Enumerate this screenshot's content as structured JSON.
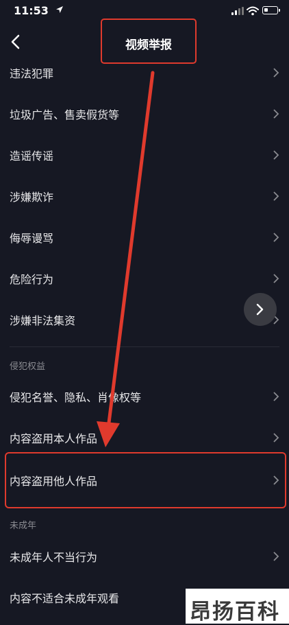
{
  "status_bar": {
    "time": "11:53"
  },
  "header": {
    "title": "视频举报"
  },
  "items_group1": [
    {
      "label": "违法犯罪"
    },
    {
      "label": "垃圾广告、售卖假货等"
    },
    {
      "label": "造谣传谣"
    },
    {
      "label": "涉嫌欺诈"
    },
    {
      "label": "侮辱谩骂"
    },
    {
      "label": "危险行为"
    },
    {
      "label": "涉嫌非法集资"
    }
  ],
  "section_rights": {
    "title": "侵犯权益"
  },
  "items_group2": [
    {
      "label": "侵犯名誉、隐私、肖像权等"
    },
    {
      "label": "内容盗用本人作品"
    },
    {
      "label": "内容盗用他人作品"
    }
  ],
  "section_minor": {
    "title": "未成年"
  },
  "items_group3": [
    {
      "label": "未成年人不当行为"
    },
    {
      "label": "内容不适合未成年观看"
    }
  ],
  "annotation": {
    "color": "#e03a2d"
  },
  "watermark": {
    "text": "昂扬百科"
  }
}
